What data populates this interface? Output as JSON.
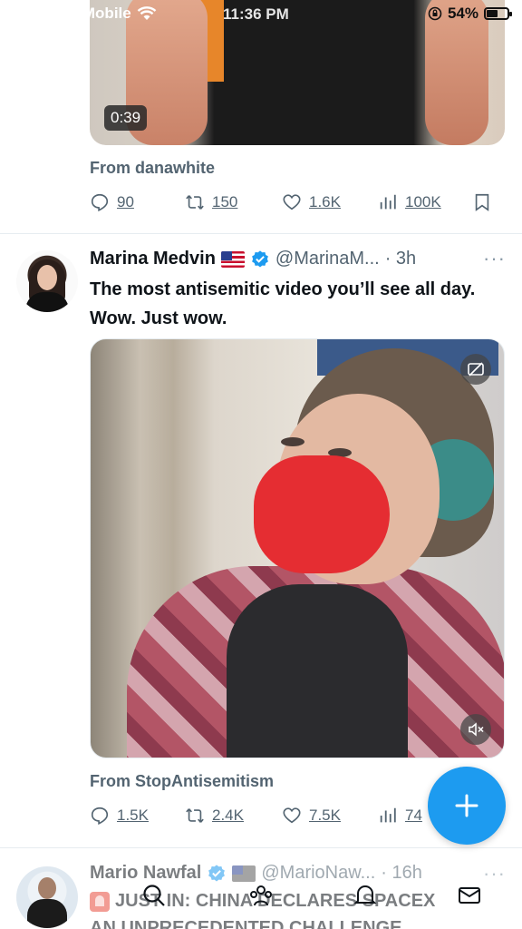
{
  "status_bar": {
    "carrier": "Boost Mobile",
    "time": "11:36 PM",
    "battery_percent": "54%",
    "battery_level": 0.54
  },
  "tweet1": {
    "video_duration": "0:39",
    "from_label": "From danawhite",
    "stats": {
      "replies": "90",
      "retweets": "150",
      "likes": "1.6K",
      "views": "100K"
    }
  },
  "tweet2": {
    "name": "Marina Medvin",
    "handle": "@MarinaM...",
    "time": "· 3h",
    "text": "The most antisemitic video you’ll see all day. Wow. Just wow.",
    "from_label": "From StopAntisemitism",
    "stats": {
      "replies": "1.5K",
      "retweets": "2.4K",
      "likes": "7.5K",
      "views": "74"
    }
  },
  "tweet3": {
    "name": "Mario Nawfal",
    "handle": "@MarioNaw...",
    "time": "· 16h",
    "text_line1": "JUST IN: CHINA DECLARES SPACEX",
    "text_line2": "AN UNPRECEDENTED CHALLENGE"
  },
  "more_label": "···",
  "fab_label": "compose"
}
